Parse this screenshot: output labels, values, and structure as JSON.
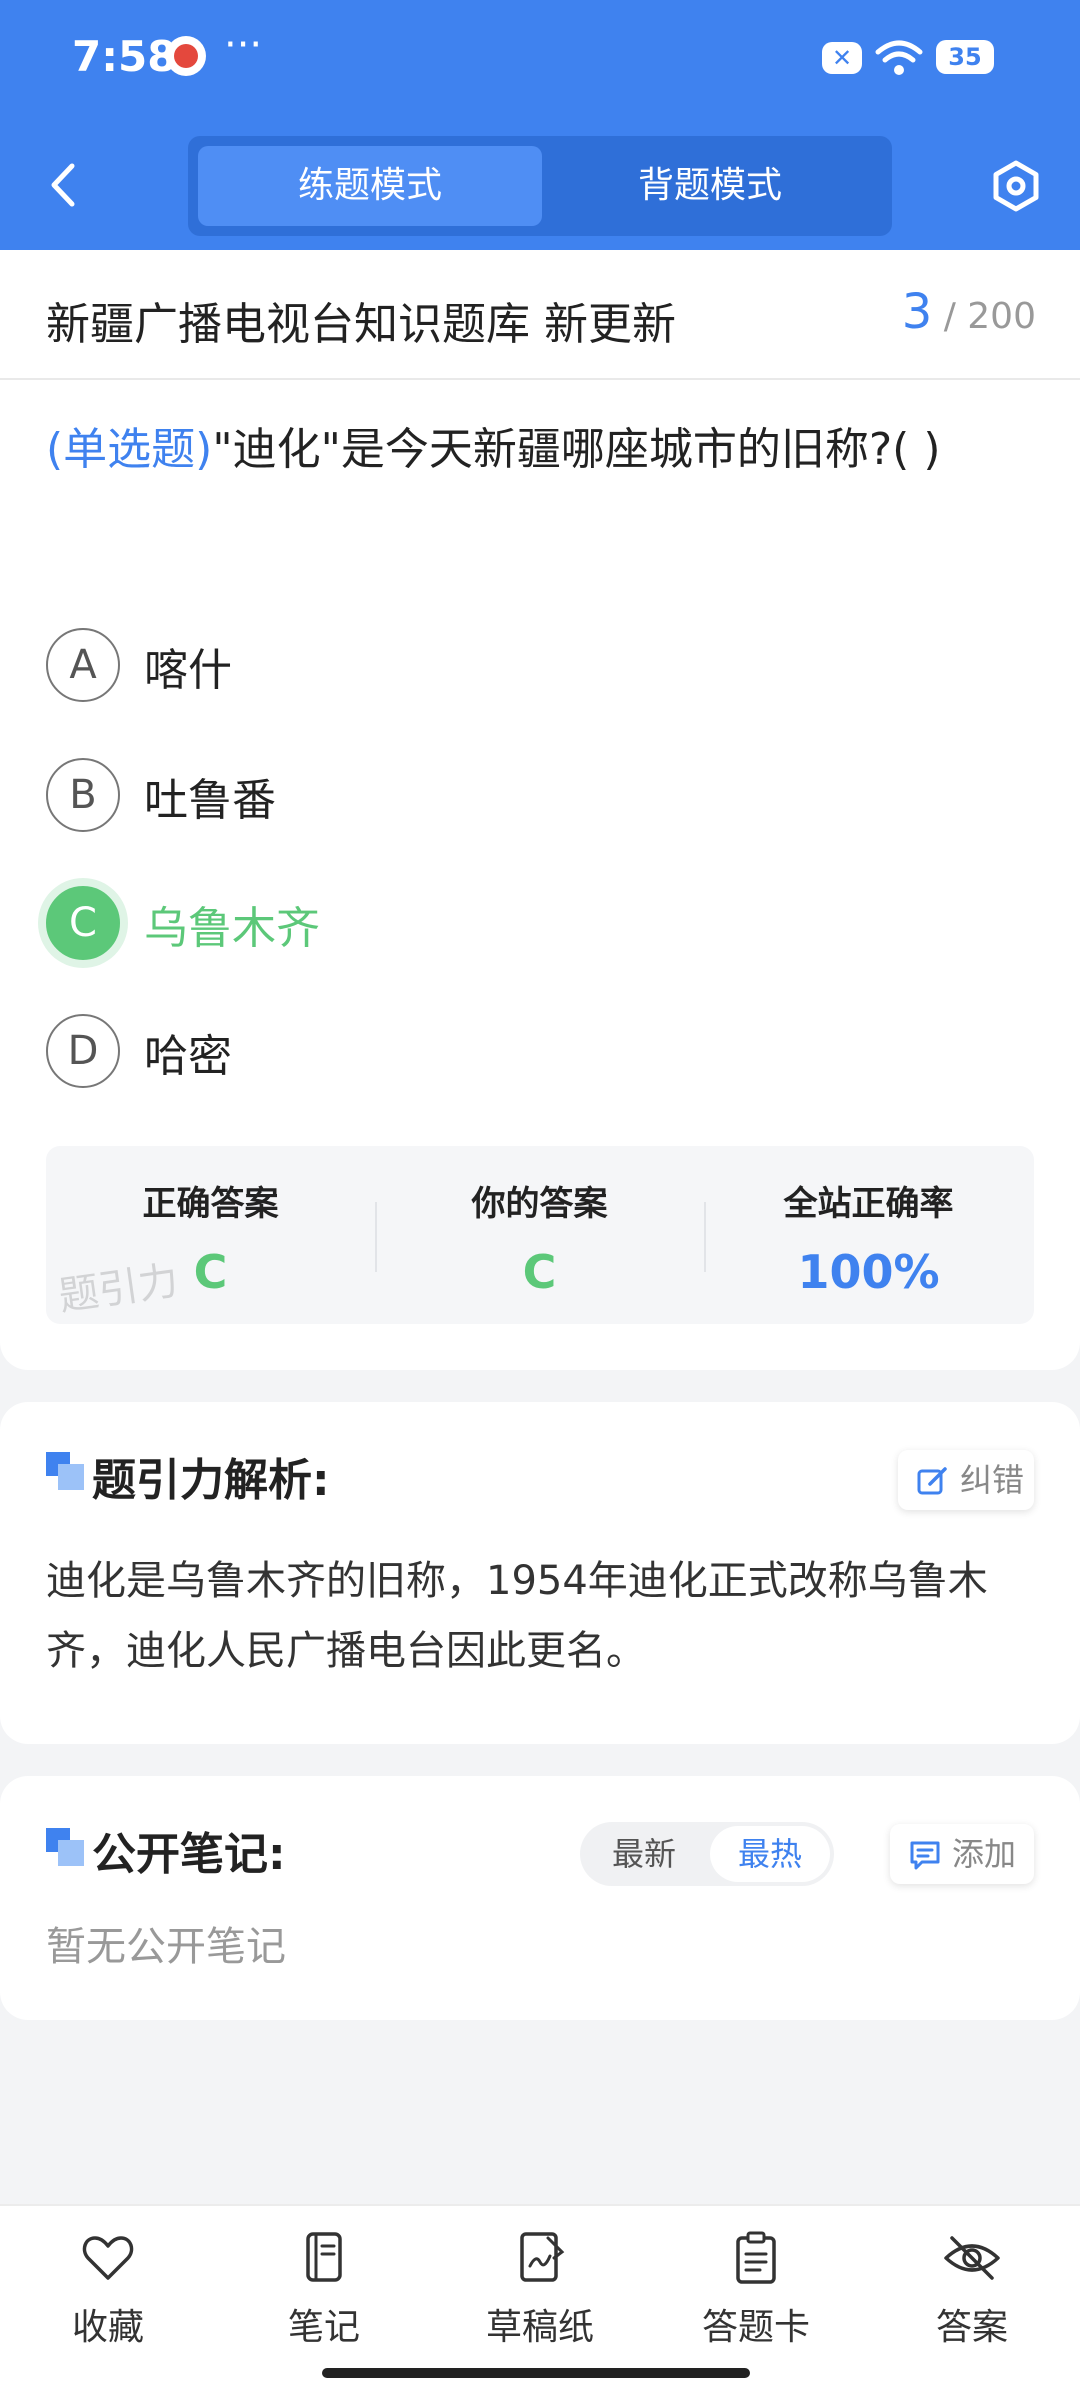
{
  "status": {
    "time": "7:58",
    "more": "···",
    "battery": "35"
  },
  "header": {
    "tabs": [
      {
        "label": "练题模式",
        "active": true
      },
      {
        "label": "背题模式",
        "active": false
      }
    ]
  },
  "question": {
    "bank_title": "新疆广播电视台知识题库 新更新",
    "current": "3",
    "total": "/ 200",
    "type": "(单选题)",
    "text": "\"迪化\"是今天新疆哪座城市的旧称?( )",
    "options": [
      {
        "letter": "A",
        "text": "喀什"
      },
      {
        "letter": "B",
        "text": "吐鲁番"
      },
      {
        "letter": "C",
        "text": "乌鲁木齐",
        "correct": true
      },
      {
        "letter": "D",
        "text": "哈密"
      }
    ]
  },
  "stats": {
    "correct_label": "正确答案",
    "correct_value": "C",
    "yours_label": "你的答案",
    "yours_value": "C",
    "rate_label": "全站正确率",
    "rate_value": "100%",
    "watermark": "题引力"
  },
  "analysis": {
    "title": "题引力解析:",
    "report_label": "纠错",
    "body": "迪化是乌鲁木齐的旧称，1954年迪化正式改称乌鲁木齐，迪化人民广播电台因此更名。"
  },
  "notes": {
    "title": "公开笔记:",
    "sort_latest": "最新",
    "sort_hot": "最热",
    "add_label": "添加",
    "empty": "暂无公开笔记"
  },
  "bottom_nav": [
    {
      "label": "收藏",
      "icon": "heart-icon"
    },
    {
      "label": "笔记",
      "icon": "notebook-icon"
    },
    {
      "label": "草稿纸",
      "icon": "draft-paper-icon"
    },
    {
      "label": "答题卡",
      "icon": "answer-sheet-icon"
    },
    {
      "label": "答案",
      "icon": "eye-off-icon"
    }
  ],
  "colors": {
    "primary": "#3f82ef",
    "correct": "#5cc879",
    "background": "#f3f4f6"
  }
}
